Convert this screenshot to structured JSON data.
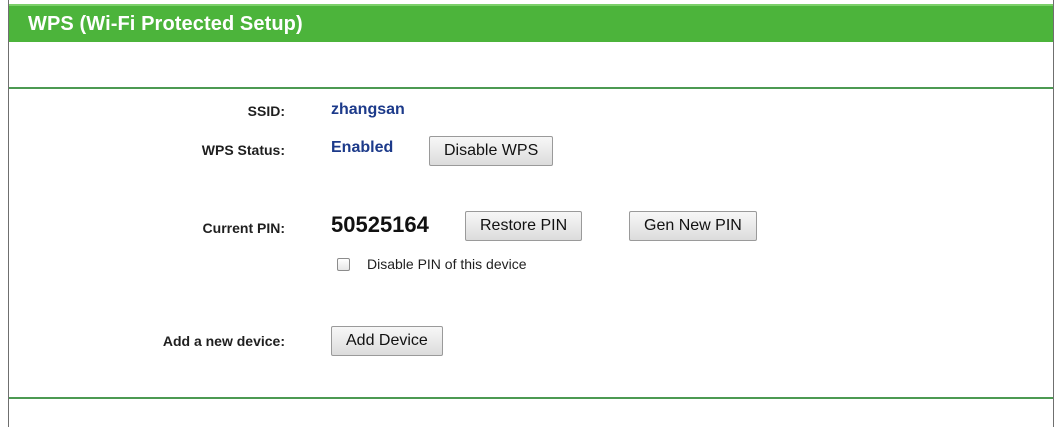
{
  "header": {
    "title": "WPS (Wi-Fi Protected Setup)"
  },
  "fields": {
    "ssid_label": "SSID:",
    "ssid_value": "zhangsan",
    "wps_status_label": "WPS Status:",
    "wps_status_value": "Enabled",
    "current_pin_label": "Current PIN:",
    "current_pin_value": "50525164",
    "add_device_label": "Add a new device:"
  },
  "buttons": {
    "disable_wps": "Disable WPS",
    "restore_pin": "Restore PIN",
    "gen_new_pin": "Gen New PIN",
    "add_device": "Add Device"
  },
  "checkbox": {
    "disable_pin_label": "Disable PIN of this device",
    "disable_pin_checked": false
  },
  "colors": {
    "title_bar": "#4cb43b",
    "divider": "#4c9a52",
    "value_blue": "#1c3a8a"
  }
}
